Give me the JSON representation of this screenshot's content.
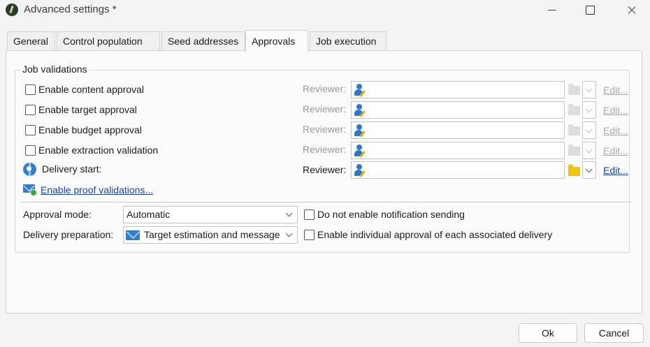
{
  "window": {
    "title": "Advanced settings *"
  },
  "tabs": [
    {
      "label": "General"
    },
    {
      "label": "Control population"
    },
    {
      "label": "Seed addresses"
    },
    {
      "label": "Approvals",
      "active": true
    },
    {
      "label": "Job execution"
    }
  ],
  "job_validations": {
    "legend": "Job validations",
    "rows": [
      {
        "label": "Enable content approval",
        "checked": false,
        "reviewer_label": "Reviewer:",
        "reviewer_value": "",
        "edit_label": "Edit...",
        "enabled": false
      },
      {
        "label": "Enable target approval",
        "checked": false,
        "reviewer_label": "Reviewer:",
        "reviewer_value": "",
        "edit_label": "Edit...",
        "enabled": false
      },
      {
        "label": "Enable budget approval",
        "checked": false,
        "reviewer_label": "Reviewer:",
        "reviewer_value": "",
        "edit_label": "Edit...",
        "enabled": false
      },
      {
        "label": "Enable extraction validation",
        "checked": false,
        "reviewer_label": "Reviewer:",
        "reviewer_value": "",
        "edit_label": "Edit...",
        "enabled": false
      }
    ],
    "delivery_start": {
      "label": "Delivery start:",
      "reviewer_label": "Reviewer:",
      "reviewer_value": "",
      "edit_label": "Edit...",
      "enabled": true
    },
    "proof_link": "Enable proof validations..."
  },
  "options": {
    "approval_mode_label": "Approval mode:",
    "approval_mode_value": "Automatic",
    "delivery_prep_label": "Delivery preparation:",
    "delivery_prep_value": "Target estimation and message personalization",
    "no_notification_label": "Do not enable notification sending",
    "no_notification_checked": false,
    "individual_approval_label": "Enable individual approval of each associated delivery",
    "individual_approval_checked": false
  },
  "buttons": {
    "ok": "Ok",
    "cancel": "Cancel"
  },
  "colors": {
    "link": "#1a3fb5",
    "accent_icon": "#2f7fd1",
    "folder": "#f2c300",
    "disabled_text": "#9a9a9a"
  }
}
